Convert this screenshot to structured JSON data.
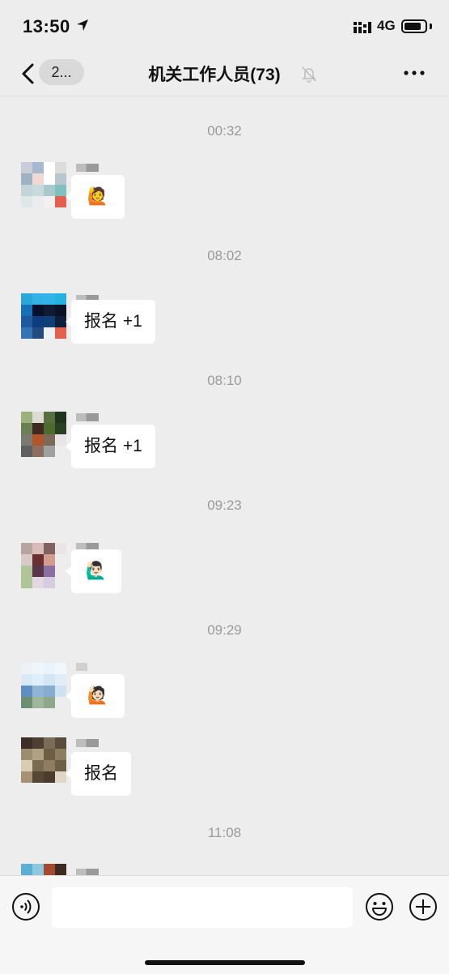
{
  "status_bar": {
    "time": "13:50",
    "network": "4G"
  },
  "nav": {
    "back_count": "2...",
    "title": "机关工作人员(73)"
  },
  "messages": [
    {
      "time": "00:32",
      "content": "🙋"
    },
    {
      "time": "08:02",
      "content": "报名 +1"
    },
    {
      "time": "08:10",
      "content": "报名 +1"
    },
    {
      "time": "09:23",
      "content": "🙋🏻‍♂️"
    },
    {
      "time": "09:29",
      "content": "🙋🏻"
    },
    {
      "time": "",
      "content": "报名"
    },
    {
      "time": "11:08",
      "content": ""
    }
  ],
  "input": {
    "value": "",
    "placeholder": ""
  },
  "icons": {
    "back": "chevron-left-icon",
    "mute": "bell-muted-icon",
    "more": "more-dots-icon",
    "voice": "voice-icon",
    "emoji": "smiley-icon",
    "plus": "plus-circle-icon"
  }
}
